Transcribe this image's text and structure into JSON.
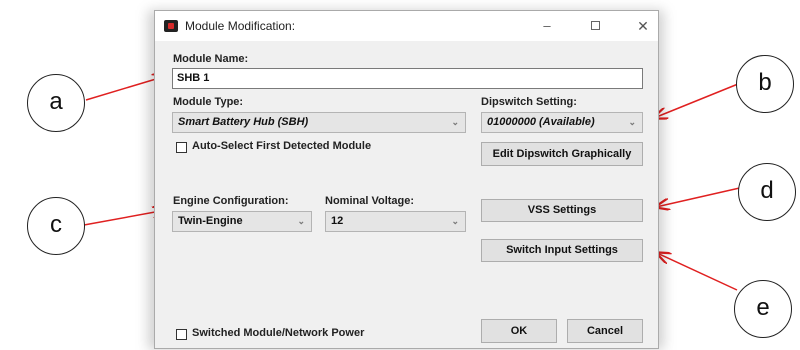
{
  "window": {
    "title": "Module Modification:",
    "minimize": "–",
    "maximize": "",
    "close": "✕",
    "icon": "app-icon"
  },
  "module_name": {
    "label": "Module Name:",
    "value": "SHB 1"
  },
  "module_type": {
    "label": "Module Type:",
    "value": "Smart Battery Hub (SBH)"
  },
  "dipswitch": {
    "label": "Dipswitch Setting:",
    "value": "01000000 (Available)",
    "edit_button": "Edit Dipswitch Graphically"
  },
  "auto_select": {
    "label": "Auto-Select First Detected Module",
    "checked": false
  },
  "engine": {
    "label": "Engine Configuration:",
    "value": "Twin-Engine"
  },
  "voltage": {
    "label": "Nominal Voltage:",
    "value": "12"
  },
  "buttons": {
    "vss": "VSS Settings",
    "switch_input": "Switch Input Settings",
    "ok": "OK",
    "cancel": "Cancel"
  },
  "switched_power": {
    "label": "Switched Module/Network Power",
    "checked": false
  },
  "callouts": {
    "a": "a",
    "b": "b",
    "c": "c",
    "d": "d",
    "e": "e"
  },
  "colors": {
    "arrow": "#e02020",
    "dialog_bg": "#f0f0f0"
  }
}
